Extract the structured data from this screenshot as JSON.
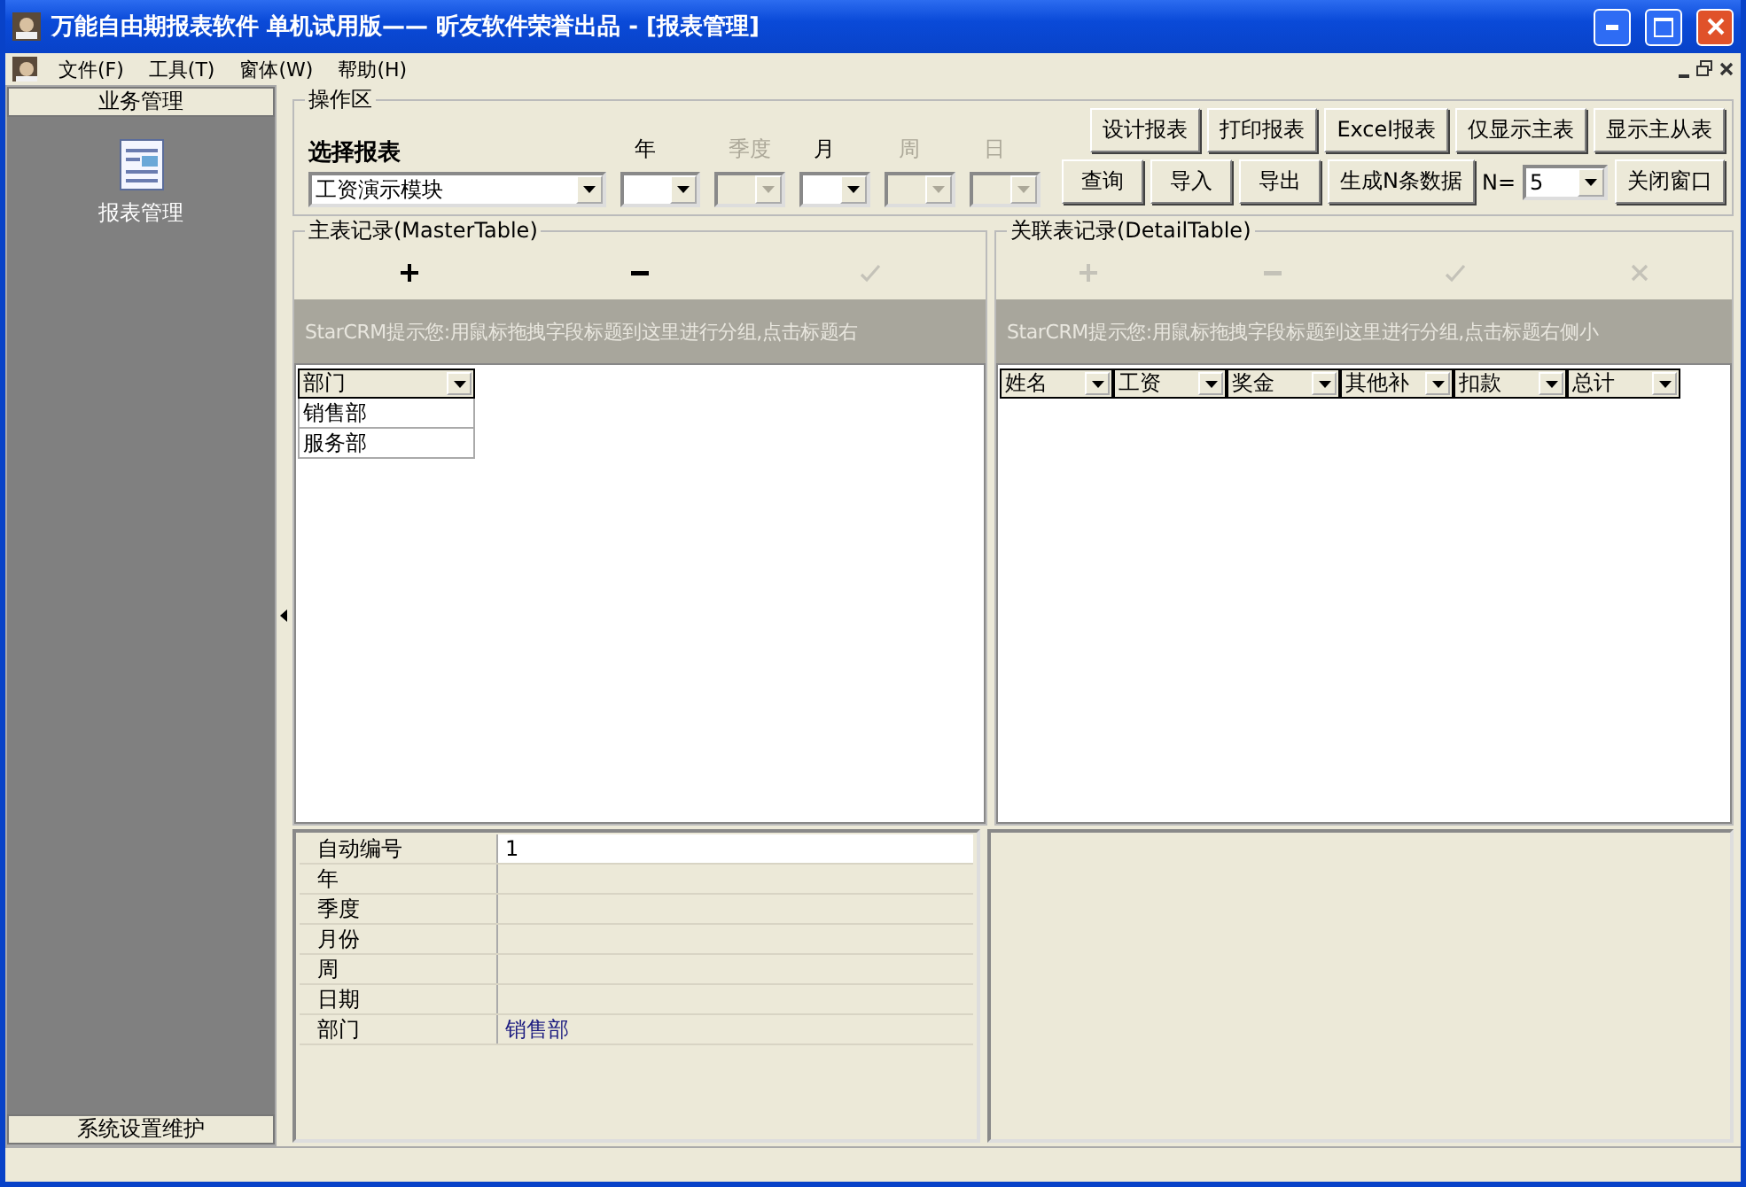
{
  "window": {
    "title": "万能自由期报表软件  单机试用版——  昕友软件荣誉出品  -  [报表管理]"
  },
  "menu": [
    "文件(F)",
    "工具(T)",
    "窗体(W)",
    "帮助(H)"
  ],
  "sidebar": {
    "header": "业务管理",
    "items": [
      {
        "label": "报表管理"
      }
    ],
    "footer": "系统设置维护"
  },
  "operations": {
    "title": "操作区",
    "report_label": "选择报表",
    "report_value": "工资演示模块",
    "date_fields": [
      {
        "label": "年",
        "disabled": false
      },
      {
        "label": "季度",
        "disabled": true
      },
      {
        "label": "月",
        "disabled": false
      },
      {
        "label": "周",
        "disabled": true
      },
      {
        "label": "日",
        "disabled": true
      }
    ],
    "buttons_top": [
      "设计报表",
      "打印报表",
      "Excel报表",
      "仅显示主表",
      "显示主从表"
    ],
    "buttons_bottom": [
      "查询",
      "导入",
      "导出",
      "生成N条数据"
    ],
    "n_label": "N=",
    "n_value": "5",
    "close_button": "关闭窗口"
  },
  "master": {
    "title": "主表记录(MasterTable)",
    "toolbar": [
      {
        "kind": "add",
        "disabled": false
      },
      {
        "kind": "remove",
        "disabled": false
      },
      {
        "kind": "confirm",
        "disabled": true
      }
    ],
    "group_hint": "StarCRM提示您:用鼠标拖拽字段标题到这里进行分组,点击标题右",
    "columns": [
      "部门"
    ],
    "rows": [
      [
        "销售部"
      ],
      [
        "服务部"
      ]
    ]
  },
  "detail": {
    "title": "关联表记录(DetailTable)",
    "toolbar": [
      {
        "kind": "add",
        "disabled": true
      },
      {
        "kind": "remove",
        "disabled": true
      },
      {
        "kind": "confirm",
        "disabled": true
      },
      {
        "kind": "cancel",
        "disabled": true
      }
    ],
    "group_hint": "StarCRM提示您:用鼠标拖拽字段标题到这里进行分组,点击标题右侧小",
    "columns": [
      "姓名",
      "工资",
      "奖金",
      "其他补",
      "扣款",
      "总计"
    ]
  },
  "properties": [
    {
      "label": "自动编号",
      "value": "1",
      "selected": true
    },
    {
      "label": "年",
      "selected": false
    },
    {
      "label": "季度",
      "selected": false
    },
    {
      "label": "月份",
      "selected": false
    },
    {
      "label": "周",
      "selected": false
    },
    {
      "label": "日期",
      "selected": false
    },
    {
      "label": "部门",
      "value": "销售部",
      "selected": false
    }
  ]
}
